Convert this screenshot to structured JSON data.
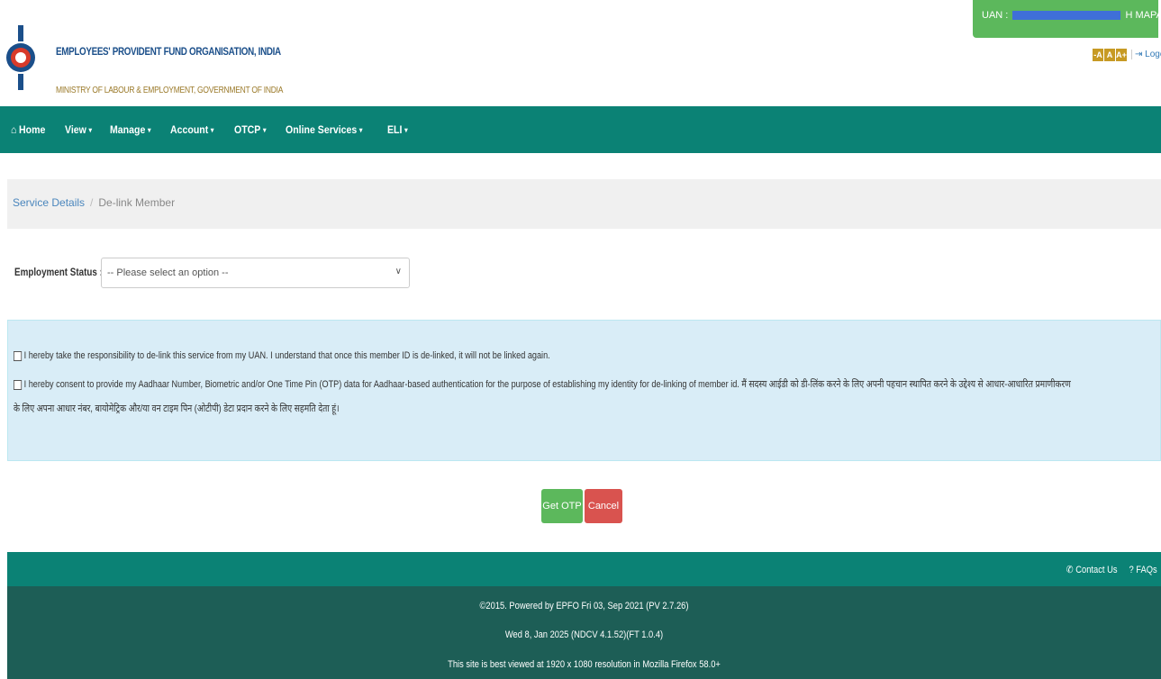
{
  "header": {
    "org_name": "EMPLOYEES' PROVIDENT FUND ORGANISATION, INDIA",
    "ministry": "MINISTRY OF LABOUR & EMPLOYMENT, GOVERNMENT OF INDIA",
    "uan_label": "UAN :",
    "uan_suffix": "H MAPARI",
    "font_buttons": [
      "-A",
      "A",
      "A+"
    ],
    "logout": "Logout"
  },
  "nav": {
    "home": "Home",
    "items": [
      "View",
      "Manage",
      "Account",
      "OTCP",
      "Online Services",
      "ELI"
    ]
  },
  "breadcrumb": {
    "parent": "Service Details",
    "separator": "/",
    "current": "De-link Member"
  },
  "form": {
    "employment_status_label": "Employment Status :",
    "employment_status_value": "-- Please select an option --"
  },
  "consent": {
    "line1": "I hereby take the responsibility to de-link this service from my UAN. I understand that once this member ID is de-linked, it will not be linked again.",
    "line2": "I hereby consent to provide my Aadhaar Number, Biometric and/or One Time Pin (OTP) data for Aadhaar-based authentication for the purpose of establishing my identity for de-linking of member id.  मैं सदस्य आईडी को डी-लिंक करने के लिए अपनी पहचान स्थापित करने के उद्देश्य से आधार-आधारित प्रमाणीकरण",
    "line3": "के लिए अपना आधार नंबर, बायोमेट्रिक और/या वन टाइम पिन (ओटीपी) डेटा प्रदान करने के लिए सहमति देता हूं।"
  },
  "buttons": {
    "get_otp": "Get OTP",
    "cancel": "Cancel"
  },
  "footer": {
    "contact": "Contact Us",
    "faqs": "FAQs",
    "line1": "©2015. Powered by EPFO Fri 03, Sep 2021 (PV 2.7.26)",
    "line2": "Wed 8, Jan 2025 (NDCV 4.1.52)(FT 1.0.4)",
    "line3": "This site is best viewed at 1920 x 1080 resolution in Mozilla Firefox 58.0+"
  },
  "colors": {
    "nav_bg": "#0b8275",
    "uan_bg": "#5cb85c",
    "panel_bg": "#d9edf7",
    "otp_btn": "#5cb85c",
    "cancel_btn": "#d9534f",
    "footer_bg": "#1d5e56"
  },
  "icons": [
    "epfo-logo-icon",
    "logout-icon",
    "home-icon",
    "phone-icon",
    "question-icon",
    "caret-down-icon"
  ]
}
